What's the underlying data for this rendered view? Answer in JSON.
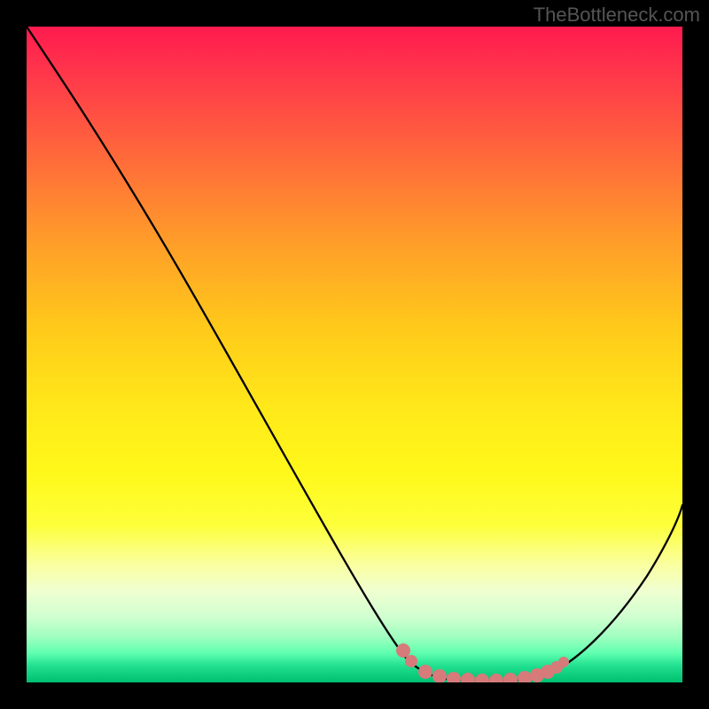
{
  "watermark": "TheBottleneck.com",
  "chart_data": {
    "type": "line",
    "title": "",
    "xlabel": "",
    "ylabel": "",
    "xlim": [
      0,
      100
    ],
    "ylim": [
      0,
      100
    ],
    "series": [
      {
        "name": "bottleneck-curve",
        "x": [
          0,
          5,
          10,
          15,
          20,
          25,
          30,
          35,
          40,
          45,
          50,
          53,
          55,
          58,
          60,
          63,
          66,
          70,
          74,
          78,
          82,
          86,
          90,
          94,
          98,
          100
        ],
        "y": [
          100,
          95,
          88,
          80,
          72,
          64,
          56,
          48,
          40,
          32,
          24,
          18,
          13,
          8,
          5,
          2.5,
          1.2,
          0.5,
          0.3,
          0.4,
          1,
          3,
          7,
          14,
          24,
          30
        ]
      }
    ],
    "highlight_band": {
      "name": "optimal-range-dots",
      "x": [
        53,
        55,
        58,
        60,
        63,
        66,
        70,
        74,
        78
      ],
      "y": [
        18,
        13,
        8,
        5,
        2.5,
        1.2,
        0.5,
        0.3,
        0.4
      ],
      "color": "#d67a7a"
    },
    "background_gradient": {
      "top": "#ff1a4f",
      "mid": "#ffe81a",
      "bottom": "#00c070"
    }
  }
}
